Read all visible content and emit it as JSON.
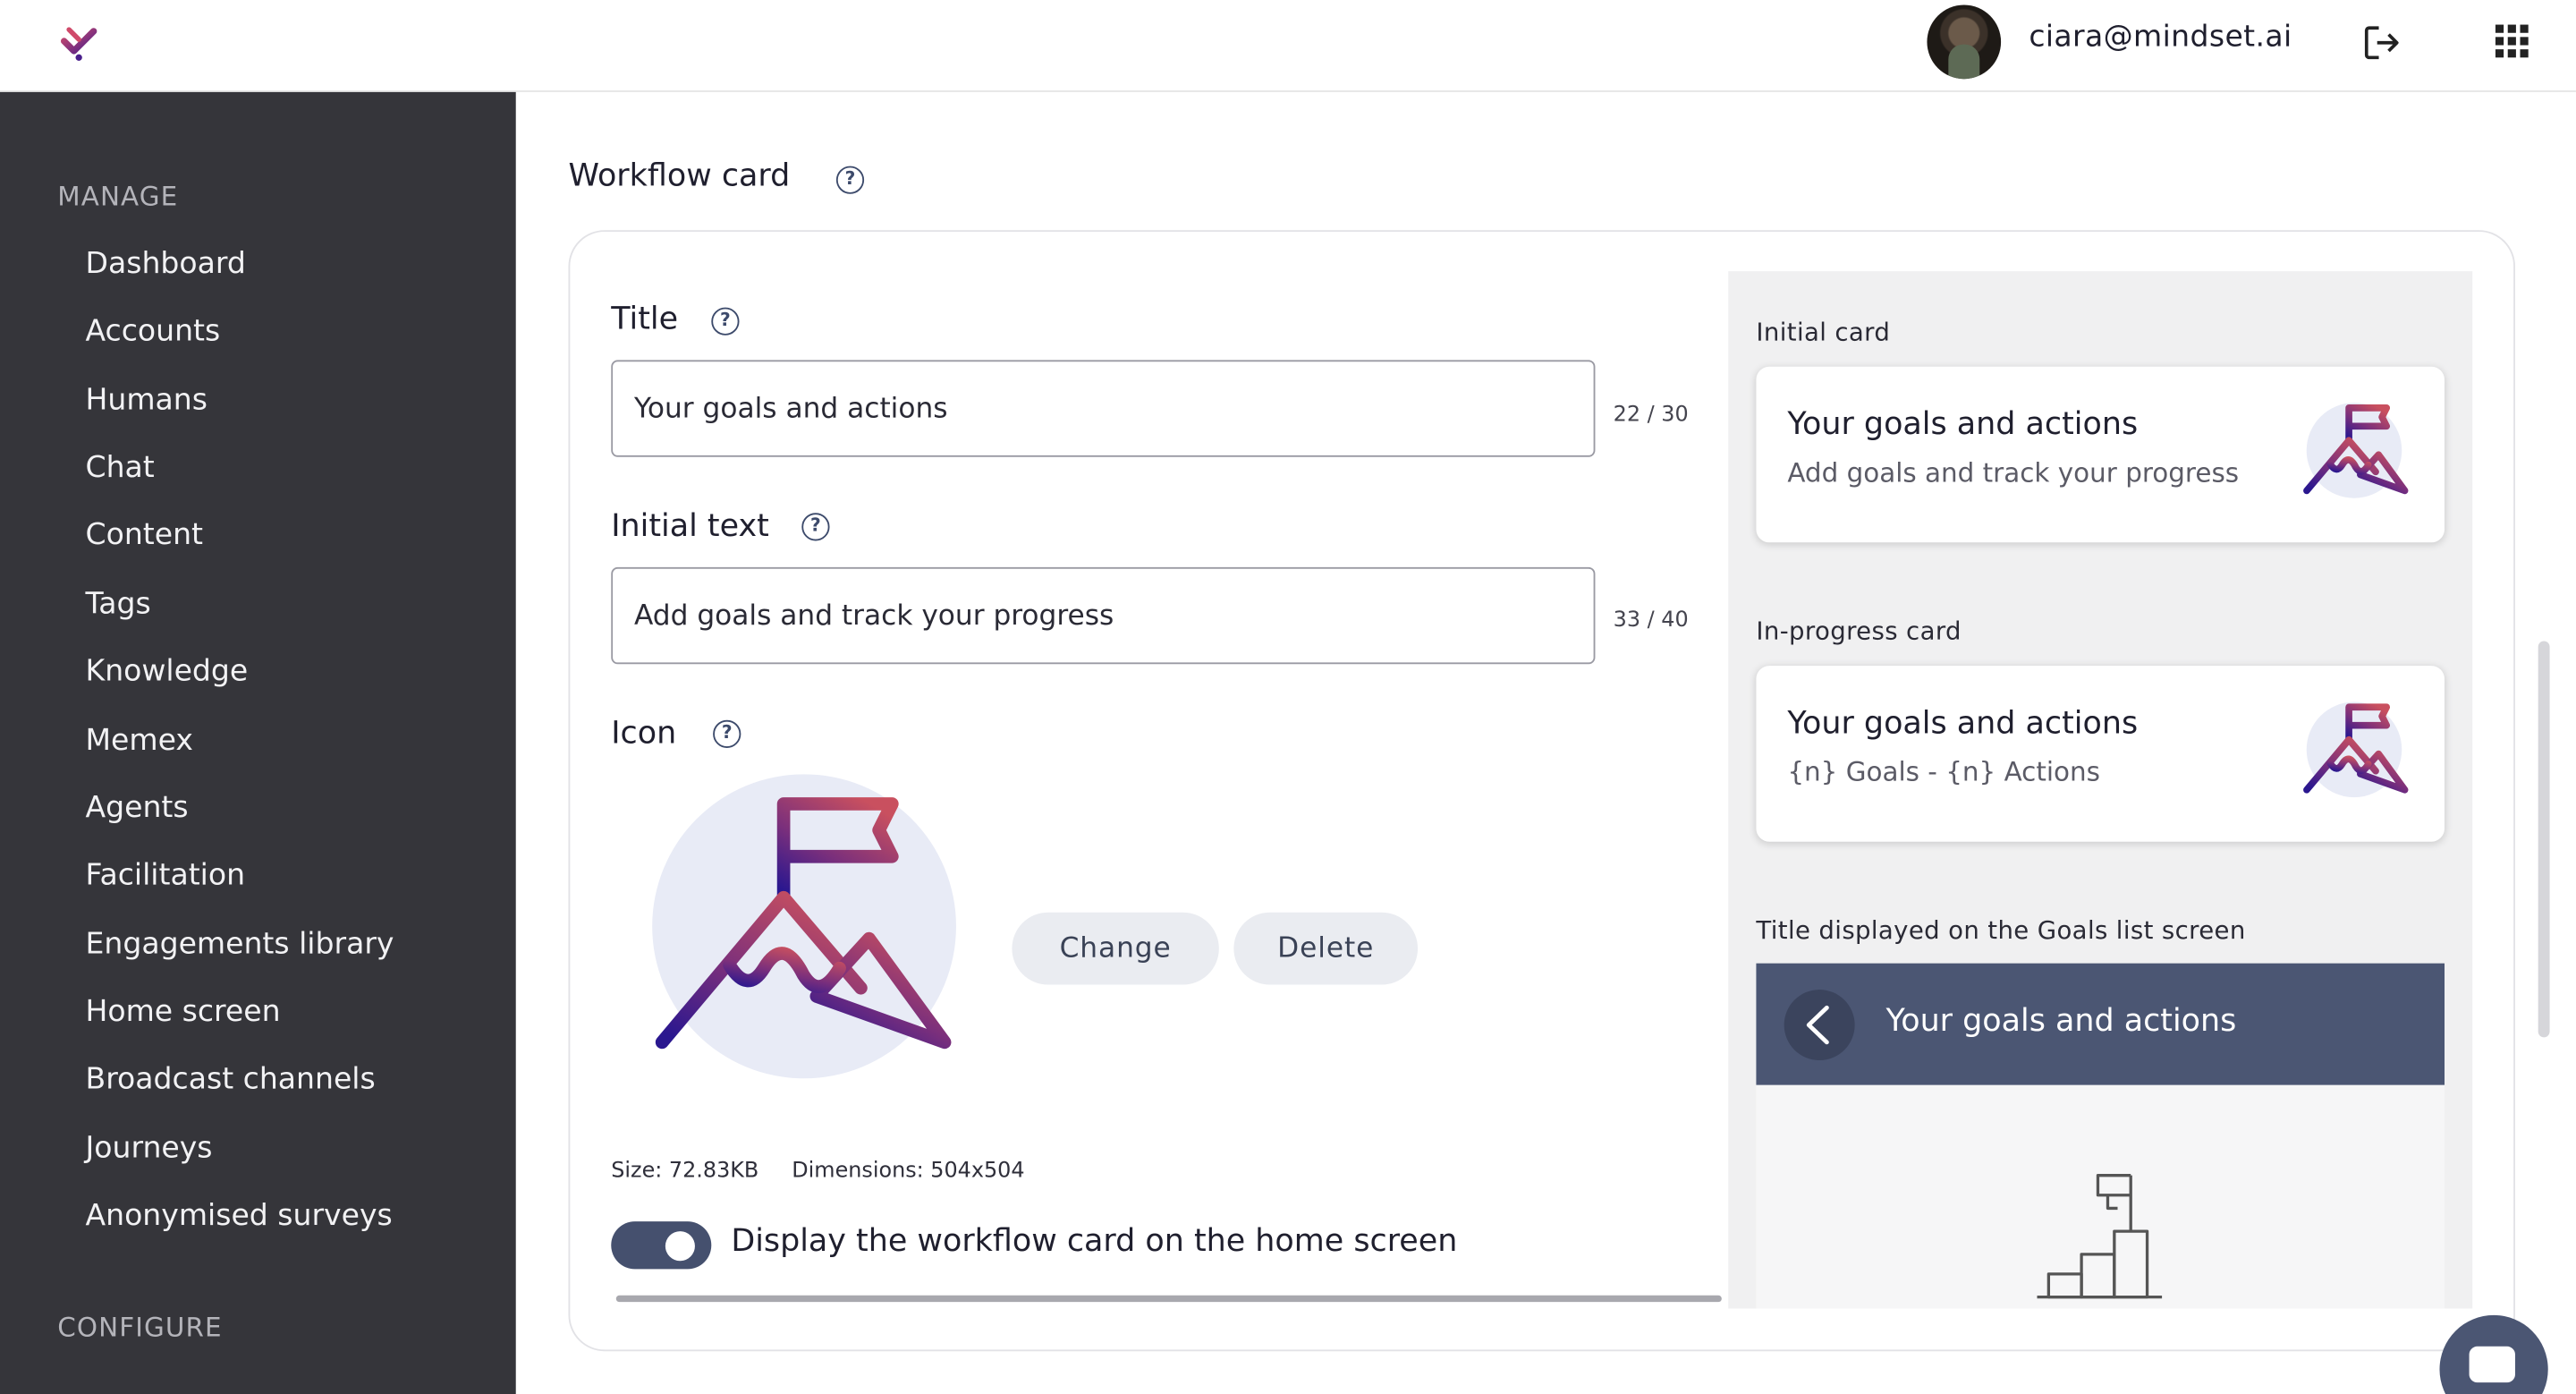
{
  "app": {
    "brand_colors": {
      "sidebar": "#35353a",
      "accent": "#45506e",
      "gradient_start": "#b8465e",
      "gradient_end": "#2a178f"
    }
  },
  "topbar": {
    "user_email": "ciara@mindset.ai",
    "logout_icon": "logout-icon",
    "apps_icon": "apps-grid-icon"
  },
  "sidebar": {
    "manage_heading": "MANAGE",
    "items": [
      {
        "label": "Dashboard"
      },
      {
        "label": "Accounts"
      },
      {
        "label": "Humans"
      },
      {
        "label": "Chat"
      },
      {
        "label": "Content"
      },
      {
        "label": "Tags"
      },
      {
        "label": "Knowledge"
      },
      {
        "label": "Memex"
      },
      {
        "label": "Agents"
      },
      {
        "label": "Facilitation"
      },
      {
        "label": "Engagements library"
      },
      {
        "label": "Home screen"
      },
      {
        "label": "Broadcast channels"
      },
      {
        "label": "Journeys"
      },
      {
        "label": "Anonymised surveys"
      }
    ],
    "configure_heading": "CONFIGURE"
  },
  "main": {
    "section_title": "Workflow card",
    "help_glyph": "?",
    "title_field": {
      "label": "Title",
      "value": "Your goals and actions",
      "counter": "22 / 30"
    },
    "initial_text_field": {
      "label": "Initial text",
      "value": "Add goals and track your progress",
      "counter": "33 / 40"
    },
    "icon_field": {
      "label": "Icon",
      "change_label": "Change",
      "delete_label": "Delete",
      "size": "Size: 72.83KB",
      "dimensions": "Dimensions: 504x504"
    },
    "toggle": {
      "label": "Display the workflow card on the home screen",
      "checked": true
    }
  },
  "preview": {
    "initial_label": "Initial card",
    "initial_card": {
      "title": "Your goals and actions",
      "subtitle": "Add goals and track your progress"
    },
    "progress_label": "In-progress card",
    "progress_card": {
      "title": "Your goals and actions",
      "subtitle": "{n} Goals - {n} Actions"
    },
    "list_label": "Title displayed on the Goals list screen",
    "list_header_title": "Your goals and actions"
  }
}
